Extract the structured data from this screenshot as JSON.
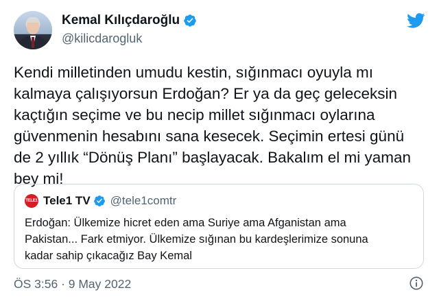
{
  "author": {
    "display_name": "Kemal Kılıçdaroğlu",
    "handle": "@kilicdarogluk"
  },
  "tweet": {
    "text": "Kendi milletinden umudu kestin, sığınmacı oyuyla mı\nkalmaya çalışıyorsun Erdoğan? Er ya da geç geleceksin\nkaçtığın seçime ve bu necip millet sığınmacı oylarına\ngüvenmenin hesabını sana kesecek. Seçimin ertesi günü\nde 2 yıllık “Dönüş Planı” başlayacak. Bakalım el mi yaman\nbey mi!",
    "timestamp": "ÖS 3:56 · 9 May 2022"
  },
  "quoted_tweet": {
    "avatar_text": "TELE1",
    "display_name": "Tele1 TV",
    "handle": "@tele1comtr",
    "text": "Erdoğan: Ülkemize hicret eden ama Suriye ama Afganistan ama\nPakistan... Fark etmiyor. Ülkemize sığınan bu kardeşlerimize sonuna\nkadar sahip çıkacağız Bay Kemal"
  },
  "icons": {
    "verified": "verified-badge-icon",
    "logo": "twitter-bird-icon",
    "info": "info-icon"
  },
  "colors": {
    "twitter_blue": "#1d9bf0",
    "text": "#0f1419",
    "secondary_text": "#536471",
    "border": "#cfd9de"
  }
}
